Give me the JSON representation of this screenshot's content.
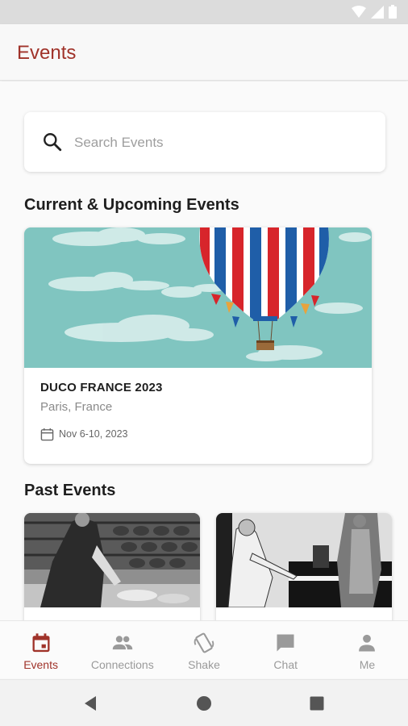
{
  "app_bar": {
    "title": "Events"
  },
  "search": {
    "placeholder": "Search Events"
  },
  "sections": {
    "current_title": "Current & Upcoming Events",
    "past_title": "Past Events"
  },
  "current_event": {
    "name": "DUCO FRANCE 2023",
    "location": "Paris, France",
    "date": "Nov  6-10, 2023"
  },
  "bottom_nav": {
    "items": [
      {
        "label": "Events",
        "icon": "calendar-icon",
        "active": true
      },
      {
        "label": "Connections",
        "icon": "people-icon",
        "active": false
      },
      {
        "label": "Shake",
        "icon": "shake-phone-icon",
        "active": false
      },
      {
        "label": "Chat",
        "icon": "chat-icon",
        "active": false
      },
      {
        "label": "Me",
        "icon": "person-icon",
        "active": false
      }
    ]
  },
  "colors": {
    "accent": "#a0332a",
    "inactive": "#9a9a9a",
    "sky": "#80c5c0"
  }
}
